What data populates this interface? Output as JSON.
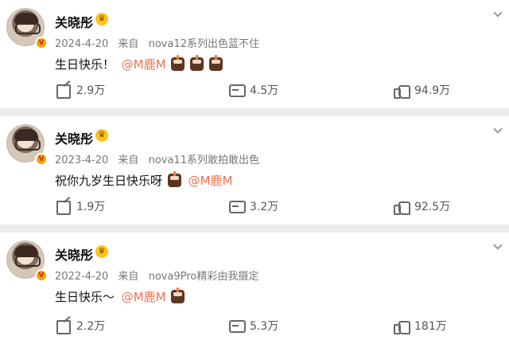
{
  "posts": [
    {
      "username": "关晓彤",
      "date": "2024-4-20",
      "source_prefix": "来自",
      "source": "nova12系列出色蓝不住",
      "text": "生日快乐！",
      "mention": "@M鹿M",
      "cake_count": 3,
      "repost_count": "2.9万",
      "comment_count": "4.5万",
      "like_count": "94.9万"
    },
    {
      "username": "关晓彤",
      "date": "2023-4-20",
      "source_prefix": "来自",
      "source": "nova11系列敢拍敢出色",
      "text": "祝你九岁生日快乐呀",
      "mention": "@M鹿M",
      "cake_count": 1,
      "repost_count": "1.9万",
      "comment_count": "3.2万",
      "like_count": "92.5万"
    },
    {
      "username": "关晓彤",
      "date": "2022-4-20",
      "source_prefix": "来自",
      "source": "nova9Pro精彩由我摄定",
      "text": "生日快乐～",
      "mention": "@M鹿M",
      "cake_count": 1,
      "repost_count": "2.2万",
      "comment_count": "5.3万",
      "like_count": "181万"
    }
  ]
}
